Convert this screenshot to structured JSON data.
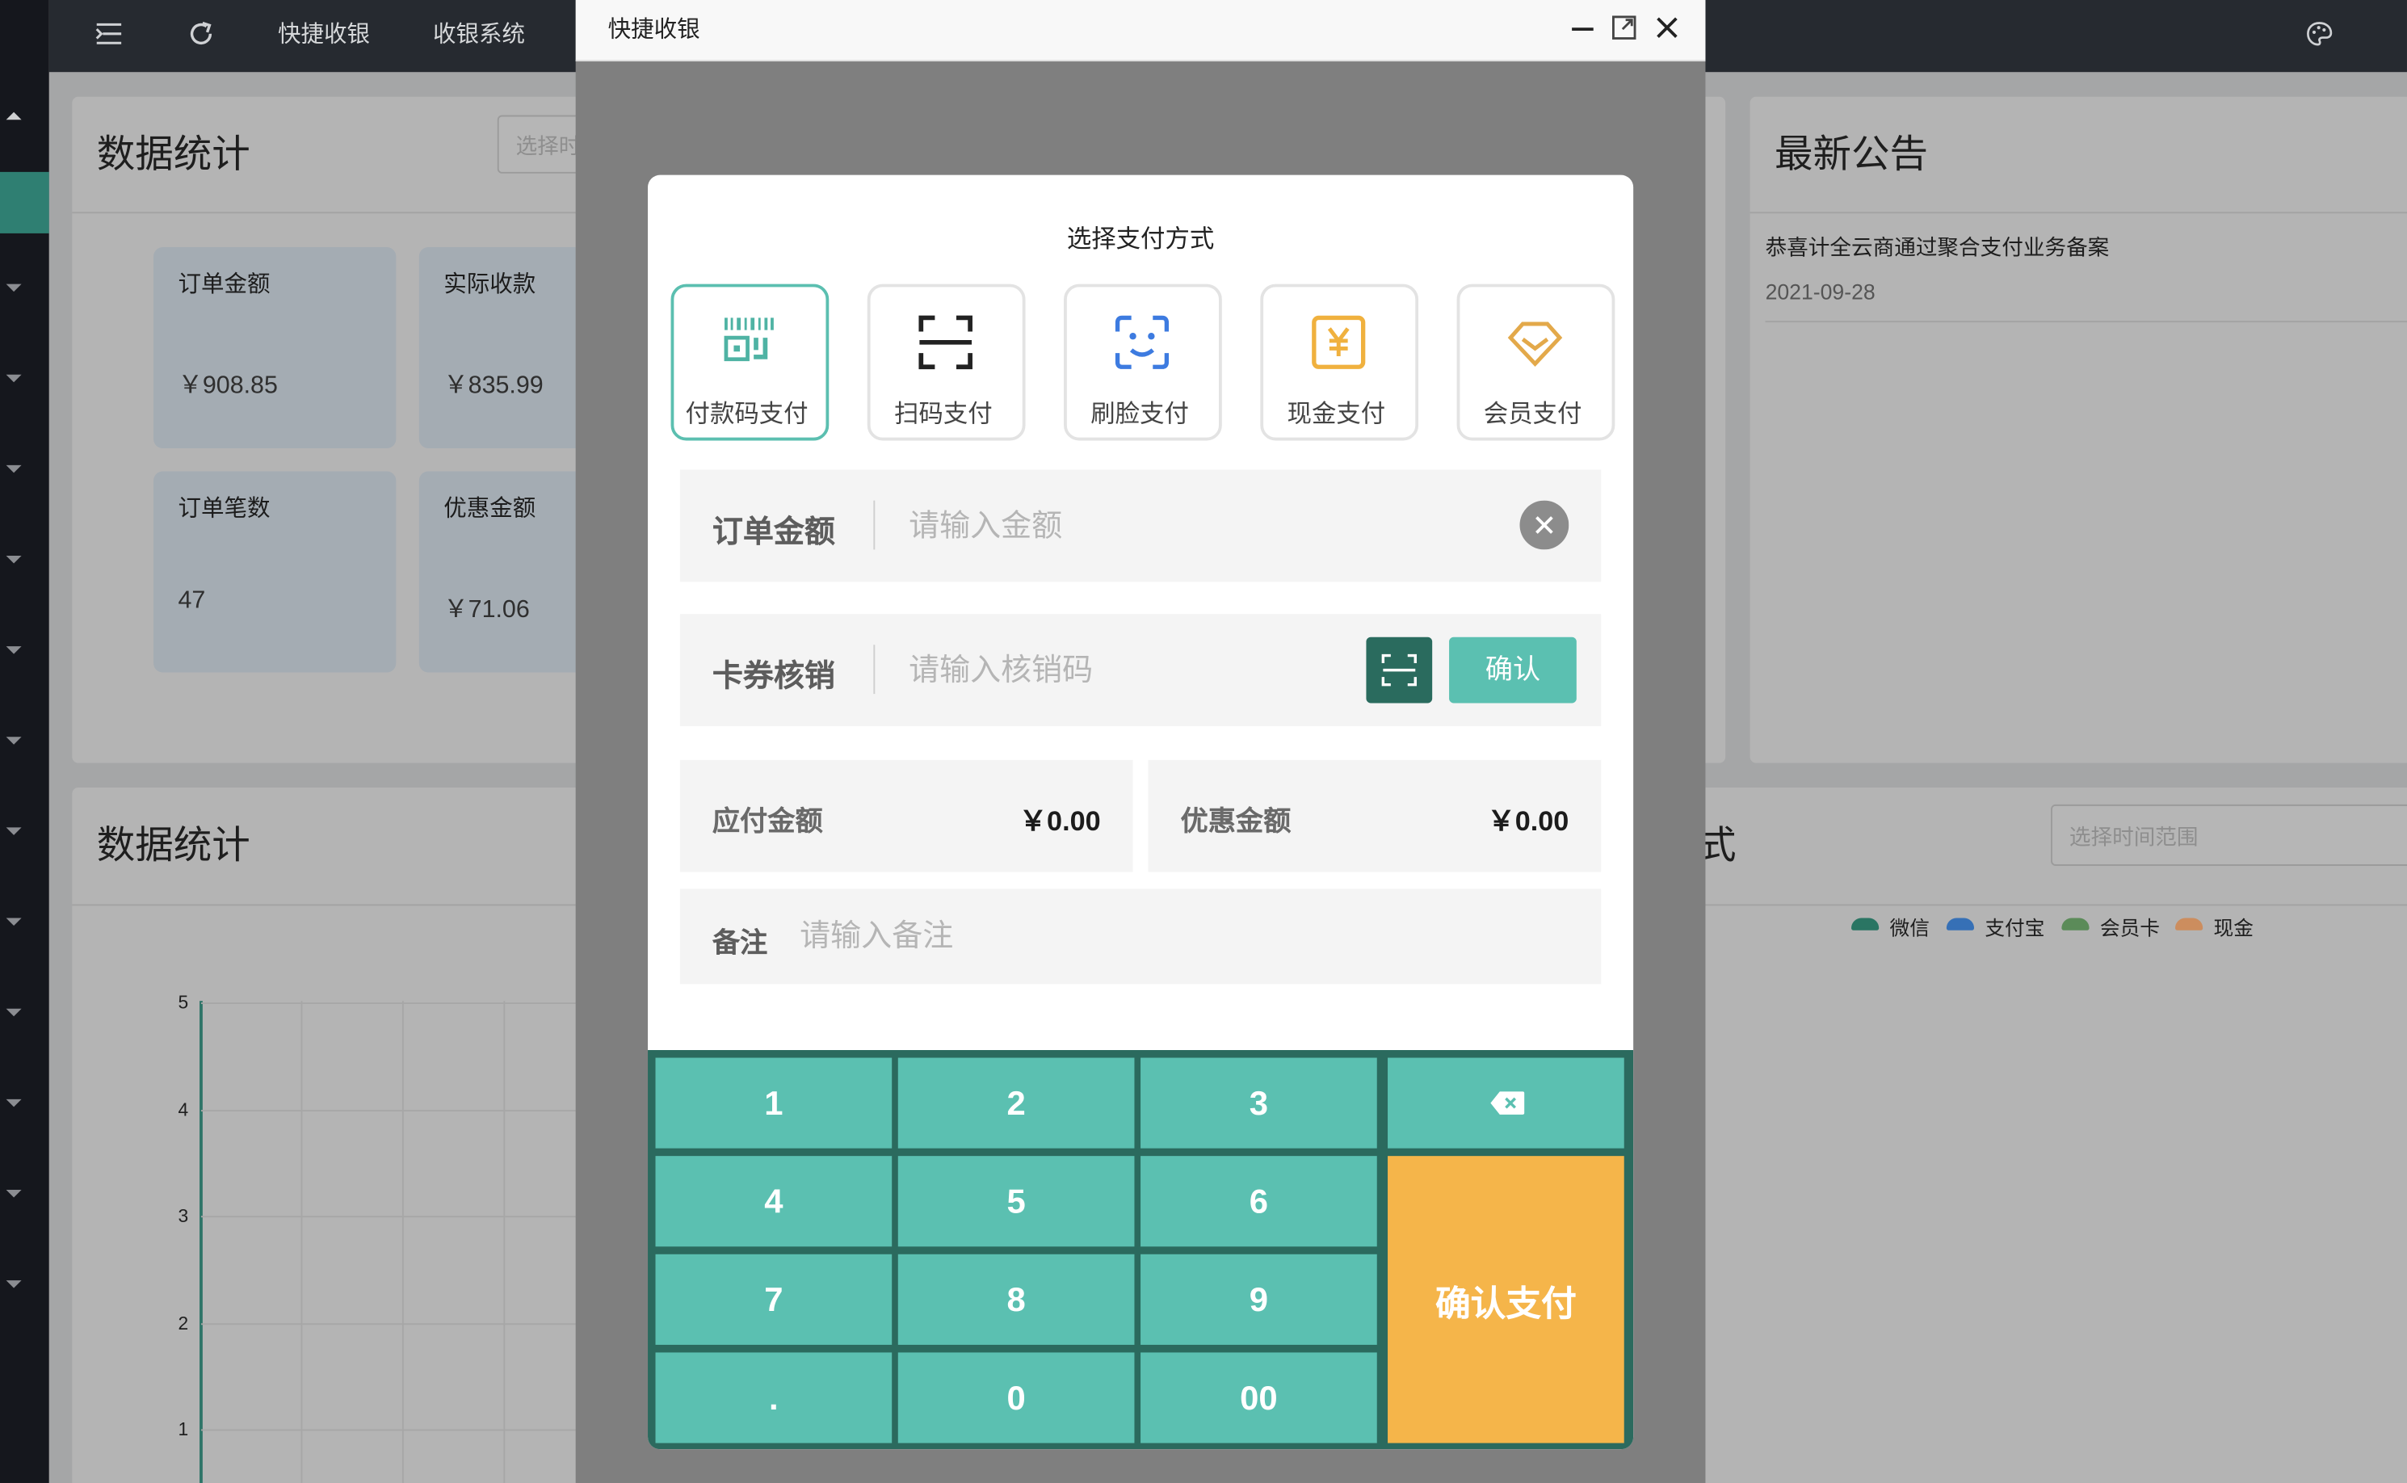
{
  "topbar": {
    "menu_quick": "快捷收银",
    "menu_cashier": "收银系统"
  },
  "stats_card": {
    "title": "数据统计",
    "date_placeholder": "选择时",
    "tiles": [
      {
        "label": "订单金额",
        "value": "￥908.85"
      },
      {
        "label": "实际收款",
        "value": "￥835.99"
      },
      {
        "label": "订单笔数",
        "value": "47"
      },
      {
        "label": "优惠金额",
        "value": "￥71.06"
      }
    ]
  },
  "notice_card": {
    "title": "最新公告",
    "items": [
      {
        "text": "恭喜计全云商通过聚合支付业务备案",
        "date": "2021-09-28"
      }
    ]
  },
  "chart_card": {
    "title": "数据统计",
    "right_title_fragment": "式",
    "date_placeholder": "选择时间范围",
    "legend": [
      "微信",
      "支付宝",
      "会员卡",
      "现金"
    ],
    "legend_colors": [
      "#2a7563",
      "#3670b6",
      "#5b8b59",
      "#cc8d5e"
    ]
  },
  "chart_data": {
    "type": "line",
    "title": "数据统计",
    "yticks": [
      "5",
      "4",
      "3",
      "2",
      "1"
    ],
    "ylim": [
      1,
      5
    ],
    "series": [
      {
        "name": "微信",
        "values": []
      },
      {
        "name": "支付宝",
        "values": []
      },
      {
        "name": "会员卡",
        "values": []
      },
      {
        "name": "现金",
        "values": []
      }
    ]
  },
  "window": {
    "title": "快捷收银",
    "controls": [
      "minimize-icon",
      "maximize-icon",
      "close-icon"
    ]
  },
  "dialog": {
    "title": "选择支付方式",
    "methods": [
      {
        "label": "付款码支付",
        "icon": "barcode-icon",
        "active": true,
        "color": "#4fb3a4"
      },
      {
        "label": "扫码支付",
        "icon": "scan-icon",
        "active": false,
        "color": "#222222"
      },
      {
        "label": "刷脸支付",
        "icon": "face-scan-icon",
        "active": false,
        "color": "#3d7be0"
      },
      {
        "label": "现金支付",
        "icon": "cash-yen-icon",
        "active": false,
        "color": "#f0b13e"
      },
      {
        "label": "会员支付",
        "icon": "diamond-icon",
        "active": false,
        "color": "#e3a94a"
      }
    ],
    "order_amount": {
      "label": "订单金额",
      "placeholder": "请输入金额",
      "value": ""
    },
    "coupon": {
      "label": "卡券核销",
      "placeholder": "请输入核销码",
      "value": "",
      "confirm": "确认"
    },
    "payable": {
      "label": "应付金额",
      "value": "￥0.00"
    },
    "discount": {
      "label": "优惠金额",
      "value": "￥0.00"
    },
    "remark": {
      "label": "备注",
      "placeholder": "请输入备注",
      "value": ""
    },
    "keys": [
      "1",
      "2",
      "3",
      "4",
      "5",
      "6",
      "7",
      "8",
      "9",
      ".",
      "0",
      "00"
    ],
    "confirm_pay": "确认支付",
    "accent": "#5bc0b1",
    "confirm_color": "#f5b54a"
  }
}
